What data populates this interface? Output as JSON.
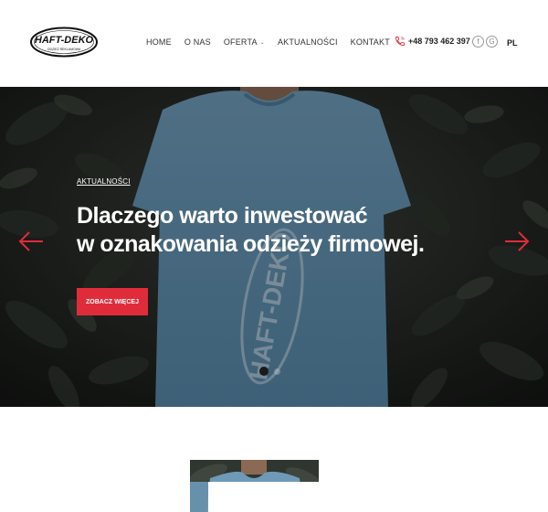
{
  "header": {
    "logo": {
      "text": "HAFT-DEKO",
      "tagline": "ODZIEŻ REKLAMOWA"
    },
    "nav": [
      {
        "label": "HOME"
      },
      {
        "label": "O NAS"
      },
      {
        "label": "OFERTA",
        "has_dropdown": true
      },
      {
        "label": "AKTUALNOŚCI"
      },
      {
        "label": "KONTAKT"
      }
    ],
    "phone": "+48 793 462 397",
    "social": {
      "facebook": "f",
      "google": "G"
    },
    "language": "PL"
  },
  "hero": {
    "category": "AKTUALNOŚCI",
    "title_line1": "Dlaczego warto inwestować",
    "title_line2": "w oznakowania odzieży firmowej.",
    "button_label": "ZOBACZ WIĘCEJ",
    "accent_color": "#e02c3a",
    "active_slide": 1,
    "slide_count": 2
  },
  "icons": {
    "phone": "phone-icon",
    "prev": "arrow-left-icon",
    "next": "arrow-right-icon",
    "dropdown": "chevron-down-icon"
  }
}
